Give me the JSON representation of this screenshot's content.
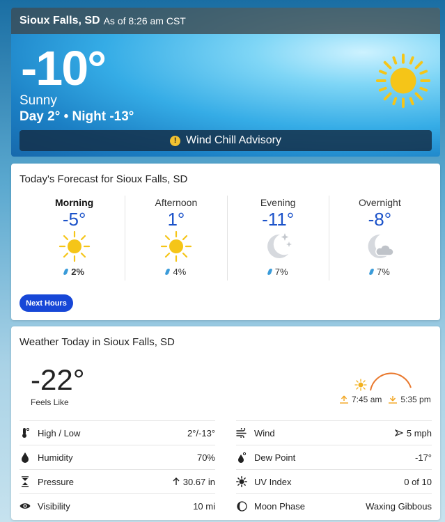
{
  "hero": {
    "city": "Sioux Falls, SD",
    "as_of": "As of 8:26 am CST",
    "temperature": "-10°",
    "condition": "Sunny",
    "day_night": "Day 2° • Night -13°",
    "condition_icon": "sun-icon",
    "alert": {
      "icon": "alert-icon",
      "label": "Wind Chill Advisory"
    }
  },
  "forecast": {
    "title": "Today's Forecast for Sioux Falls, SD",
    "periods": [
      {
        "name": "Morning",
        "temp": "-5°",
        "icon": "sun-icon",
        "precip": "2%"
      },
      {
        "name": "Afternoon",
        "temp": "1°",
        "icon": "sun-icon",
        "precip": "4%"
      },
      {
        "name": "Evening",
        "temp": "-11°",
        "icon": "moon-stars-icon",
        "precip": "7%"
      },
      {
        "name": "Overnight",
        "temp": "-8°",
        "icon": "moon-cloud-icon",
        "precip": "7%"
      }
    ],
    "next_hours_label": "Next Hours"
  },
  "today": {
    "title": "Weather Today in Sioux Falls, SD",
    "feels_like_temp": "-22°",
    "feels_like_label": "Feels Like",
    "sunrise": "7:45 am",
    "sunset": "5:35 pm",
    "details": [
      {
        "label": "High / Low",
        "value": "2°/-13°",
        "icon": "thermometer-icon"
      },
      {
        "label": "Wind",
        "value": "5 mph",
        "icon": "wind-icon",
        "value_icon": "wind-direction-icon"
      },
      {
        "label": "Humidity",
        "value": "70%",
        "icon": "humidity-icon"
      },
      {
        "label": "Dew Point",
        "value": "-17°",
        "icon": "dew-point-icon"
      },
      {
        "label": "Pressure",
        "value": "30.67 in",
        "icon": "pressure-icon",
        "value_icon": "arrow-up-icon"
      },
      {
        "label": "UV Index",
        "value": "0 of 10",
        "icon": "uv-index-icon"
      },
      {
        "label": "Visibility",
        "value": "10 mi",
        "icon": "visibility-icon"
      },
      {
        "label": "Moon Phase",
        "value": "Waxing Gibbous",
        "icon": "moon-phase-icon"
      }
    ]
  },
  "colors": {
    "accent_blue": "#1b52c9",
    "button_blue": "#1747d7",
    "sun_yellow": "#f5c518",
    "sun_arc_orange": "#e9782d",
    "alert_yellow": "#f2c230"
  }
}
